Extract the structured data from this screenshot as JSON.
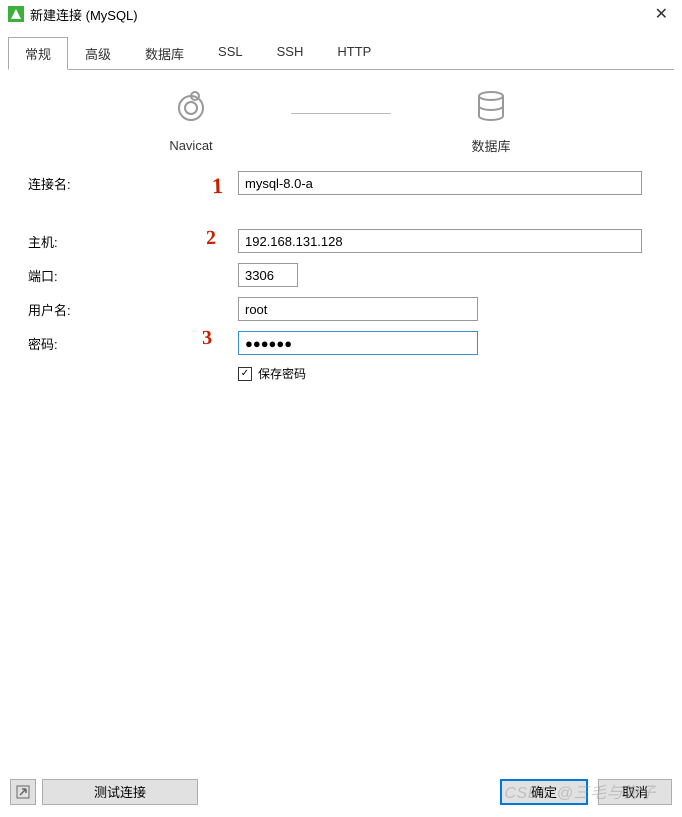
{
  "window": {
    "title": "新建连接 (MySQL)"
  },
  "tabs": {
    "general": "常规",
    "advanced": "高级",
    "database": "数据库",
    "ssl": "SSL",
    "ssh": "SSH",
    "http": "HTTP"
  },
  "diagram": {
    "left": "Navicat",
    "right": "数据库"
  },
  "labels": {
    "connName": "连接名:",
    "host": "主机:",
    "port": "端口:",
    "user": "用户名:",
    "pass": "密码:",
    "savePass": "保存密码"
  },
  "values": {
    "connName": "mysql-8.0-a",
    "host": "192.168.131.128",
    "port": "3306",
    "user": "root",
    "pass": "●●●●●●"
  },
  "annotations": {
    "one": "1",
    "two": "2",
    "three": "3"
  },
  "footer": {
    "test": "测试连接",
    "ok": "确定",
    "cancel": "取消"
  },
  "watermark": "CSDN @三毛与海子"
}
